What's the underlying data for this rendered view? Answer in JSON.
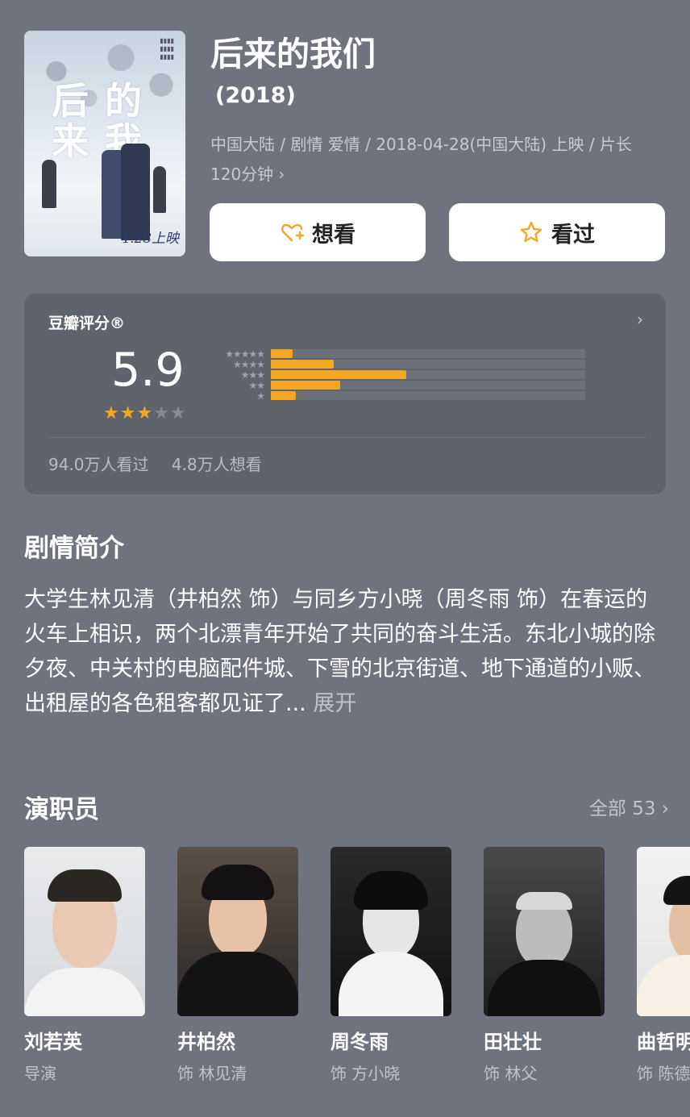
{
  "movie": {
    "title": "后来的我们",
    "year": "(2018)",
    "meta": "中国大陆 / 剧情 爱情 / 2018-04-28(中国大陆) 上映 / 片长120分钟",
    "poster": {
      "title_line1": "后来的我们",
      "date": "4.28上映"
    }
  },
  "actions": {
    "want_label": "想看",
    "seen_label": "看过"
  },
  "rating": {
    "label": "豆瓣评分®",
    "score": "5.9",
    "stars_filled": 3,
    "stars_total": 5,
    "distribution": [
      {
        "stars": "★★★★★",
        "percent": 7
      },
      {
        "stars": "★★★★",
        "percent": 20
      },
      {
        "stars": "★★★",
        "percent": 43
      },
      {
        "stars": "★★",
        "percent": 22
      },
      {
        "stars": "★",
        "percent": 8
      }
    ],
    "watched": "94.0万人看过",
    "wishlist": "4.8万人想看"
  },
  "synopsis": {
    "title": "剧情简介",
    "text": "大学生林见清（井柏然 饰）与同乡方小晓（周冬雨 饰）在春运的火车上相识，两个北漂青年开始了共同的奋斗生活。东北小城的除夕夜、中关村的电脑配件城、下雪的北京街道、地下通道的小贩、出租屋的各色租客都见证了...",
    "expand": "展开"
  },
  "cast": {
    "title": "演职员",
    "all": "全部 53",
    "members": [
      {
        "name": "刘若英",
        "role": "导演"
      },
      {
        "name": "井柏然",
        "role": "饰 林见清"
      },
      {
        "name": "周冬雨",
        "role": "饰 方小晓"
      },
      {
        "name": "田壮壮",
        "role": "饰 林父"
      },
      {
        "name": "曲哲明",
        "role": "饰 陈德"
      }
    ]
  },
  "colors": {
    "background": "#6f737d",
    "card": "#5f636c",
    "accent": "#f5a623"
  }
}
